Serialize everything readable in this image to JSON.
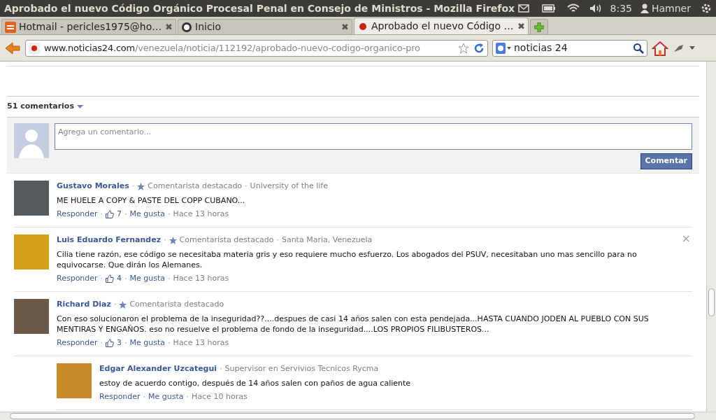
{
  "top_panel": {
    "title": "Aprobado el nuevo Código Orgánico Procesal Penal en Consejo de Ministros - Mozilla Firefox",
    "time": "8:35",
    "user": "Hamner"
  },
  "tabs": [
    {
      "label": "Hotmail - pericles1975@ho…",
      "selected": false,
      "close": "✖"
    },
    {
      "label": "Inicio",
      "selected": false,
      "close": "✖"
    },
    {
      "label": "Aprobado el nuevo Código …",
      "selected": true,
      "close": "✖"
    }
  ],
  "nav": {
    "url_host": "www.noticias24.com",
    "url_path": "/venezuela/noticia/112192/aprobado-nuevo-codigo-organico-pro",
    "search_value": "noticias 24"
  },
  "comments_section": {
    "count_label": "51 comentarios",
    "input_placeholder": "Agrega un comentario...",
    "submit": "Comentar",
    "separator": "·",
    "comments": [
      {
        "author": "Gustavo Morales",
        "featured": true,
        "badge": "Comentarista destacado",
        "affiliation": "University of the life",
        "text": "ME HUELE A COPY & PASTE DEL COPP CUBANO...",
        "reply": "Responder",
        "likes": "7",
        "like": "Me gusta",
        "time": "Hace 13 horas"
      },
      {
        "author": "Luis Eduardo Fernandez",
        "featured": true,
        "badge": "Comentarista destacado",
        "affiliation": "Santa Maria, Venezuela",
        "text": "Cilia tiene razón, ese código se necesitaba materia gris y eso requiere mucho esfuerzo. Los abogados del PSUV, necesitaban uno mas sencillo para no equivocarse. Que dirán los Alemanes.",
        "reply": "Responder",
        "likes": "4",
        "like": "Me gusta",
        "time": "Hace 13 horas",
        "close": "×"
      },
      {
        "author": "Richard Diaz",
        "featured": true,
        "badge": "Comentarista destacado",
        "text": "Con eso solucionaron el problema de la inseguridad??....despues de casi 14 años salen con esta pendejada...HASTA CUANDO JODEN AL PUEBLO CON SUS MENTIRAS Y ENGAÑOS. eso no resuelve el problema de fondo de la inseguridad....LOS PROPIOS FILIBUSTEROS...",
        "reply": "Responder",
        "likes": "3",
        "like": "Me gusta",
        "time": "Hace 13 horas",
        "children": [
          {
            "author": "Edgar Alexander Uzcategui",
            "affiliation": "Supervisor en Servivios Tecnicos Rycma",
            "text": "estoy de acuerdo contigo, después de 14 años salen con paños de agua caliente",
            "reply": "Responder",
            "like": "Me gusta",
            "time": "Hace 10 horas"
          }
        ]
      }
    ]
  }
}
